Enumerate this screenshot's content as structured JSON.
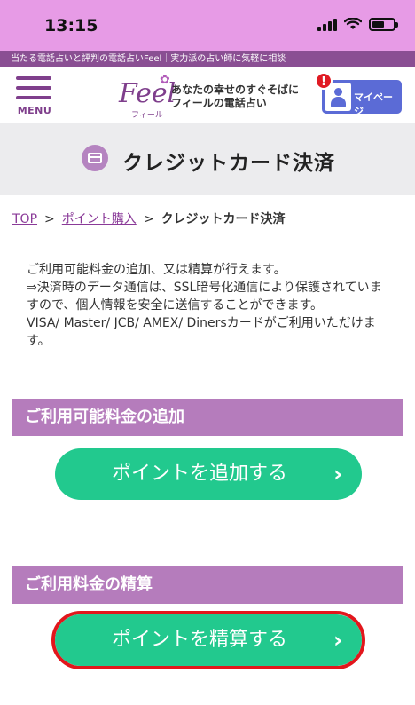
{
  "status_bar": {
    "time": "13:15"
  },
  "tagline": "当たる電話占いと評判の電話占いFeel｜実力派の占い師に気軽に相談",
  "header": {
    "menu_label": "MENU",
    "logo_text": "Feel",
    "logo_sub": "フィール",
    "catch_line1": "あなたの幸せのすぐそばに",
    "catch_line2": "フィールの電話占い",
    "mypage_label": "マイページ",
    "alert_badge": "!"
  },
  "page_title": "クレジットカード決済",
  "breadcrumb": {
    "top": "TOP",
    "sep": ">",
    "points": "ポイント購入",
    "current": "クレジットカード決済"
  },
  "description": {
    "line1": "ご利用可能料金の追加、又は精算が行えます。",
    "line2": "⇒決済時のデータ通信は、SSL暗号化通信により保護されていますので、個人情報を安全に送信することができます。",
    "line3": "VISA/ Master/ JCB/ AMEX/ Dinersカードがご利用いただけます。"
  },
  "sections": [
    {
      "header": "ご利用可能料金の追加",
      "button_label": "ポイントを追加する",
      "chevron": "›"
    },
    {
      "header": "ご利用料金の精算",
      "button_label": "ポイントを精算する",
      "chevron": "›"
    }
  ],
  "icons": {
    "menu": "hamburger-icon",
    "mypage": "person-icon",
    "title": "credit-card-icon",
    "chevron": "chevron-right-icon"
  },
  "colors": {
    "status_bar": "#e79be6",
    "brand_purple": "#7f3f8c",
    "section_header": "#b57cbc",
    "action_button": "#22c98e",
    "mypage_button": "#5b6bd6",
    "highlight": "#e2161c"
  }
}
